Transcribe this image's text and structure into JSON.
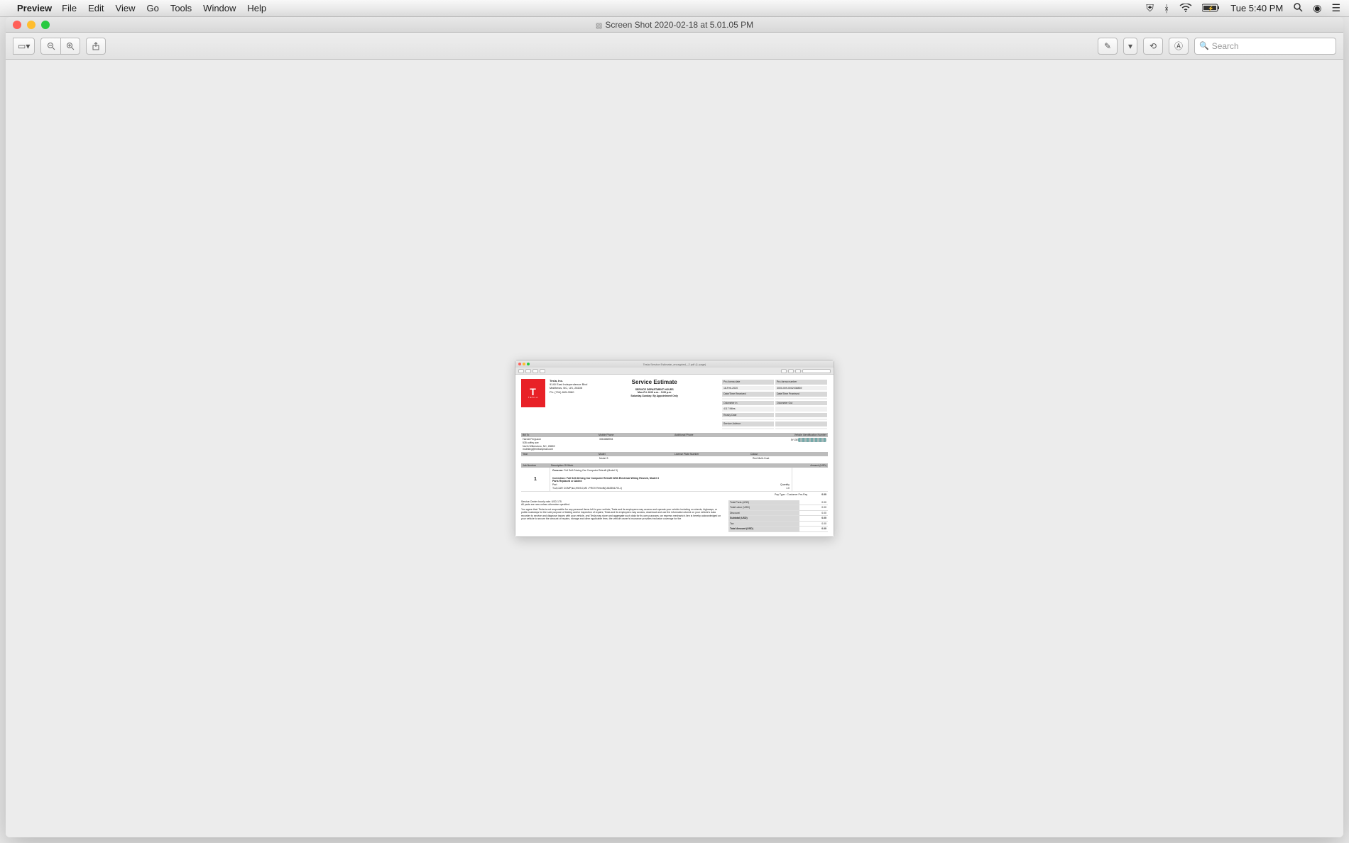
{
  "menubar": {
    "app": "Preview",
    "items": [
      "File",
      "Edit",
      "View",
      "Go",
      "Tools",
      "Window",
      "Help"
    ],
    "clock": "Tue 5:40 PM"
  },
  "window": {
    "title": "Screen Shot 2020-02-18 at 5.01.05 PM",
    "search_placeholder": "Search"
  },
  "inner": {
    "title": "Tesla Service Estimate_encrypted_-2.pdf (1 page)"
  },
  "doc": {
    "company": {
      "name": "Tesla, Inc.",
      "addr1": "9140 East Independence Blvd",
      "addr2": "Matthews, NC, US, 28105",
      "phone": "Ph: (704) 845-0980"
    },
    "title": "Service Estimate",
    "dept": {
      "header": "SERVICE DEPARTMENT HOURS",
      "line1": "Mon-Fri: 8:00 a.m. - 5:00 p.m",
      "line2": "Saturday-Sunday: By Appointment Only"
    },
    "meta": {
      "proforma_date_lbl": "Pro-forma date",
      "proforma_date": "18-Feb-2020",
      "proforma_num_lbl": "Pro-forma number",
      "proforma_num": "3000-009-0002038839",
      "dt_recv_lbl": "Date/Time Received",
      "dt_prom_lbl": "Date/Time Promised",
      "odo_in_lbl": "Odometer In",
      "odo_in": "4117 Miles",
      "odo_out_lbl": "Odometer Out",
      "ready_lbl": "Ready Date",
      "advisor_lbl": "Service Advisor"
    },
    "cust": {
      "billto_lbl": "Bill To",
      "mobile_lbl": "Mobile Phone",
      "addl_lbl": "Additional Phone",
      "vin_lbl": "Vehicle Identification Number",
      "name": "Harold Ferguson",
      "addr": "535 coffey ave",
      "city": "North Wilkesboro, NC, 28659",
      "email": "mulefarg@embarqmail.com",
      "mobile": "3364688904",
      "vin_prefix": "5YJ3E",
      "year_lbl": "Year",
      "model_lbl": "Model",
      "plate_lbl": "License Plate Number",
      "color_lbl": "Colour",
      "model": "Model 3",
      "color": "Red Multi-Coat"
    },
    "job": {
      "hdr_num": "Job Number",
      "hdr_desc": "Description Of Work",
      "hdr_amt": "Amount (USD)",
      "num": "1",
      "concern_lbl": "Concern:",
      "concern": "Full Self-Driving Car Computer Retrofit (Model 3)",
      "correction_lbl": "Correction:",
      "correction": "Full Self-Driving Car Computer Retrofit With Electrical Wiring Rework, Model 3",
      "parts_lbl": "Parts Replaced or Added",
      "part_lbl": "Part",
      "qty_lbl": "Quantity",
      "part": "TLA,CAR COMP,NA,HW3.0,M3 -PROV Retrofit(1462554-R0-J)",
      "qty": "1.0",
      "paytype_lbl": "Pay Type : Customer Pre-Pay",
      "paytype_amt": "0.00"
    },
    "footer": {
      "rate": "Service Center hourly rate: USD 175",
      "new": "All parts are new unless otherwise specified.",
      "disc": "You agree that: Tesla is not responsible for any personal items left in your vehicle; Tesla and its employees may access and operate your vehicle including on streets, highways, or public roadways for the sole purpose of testing and/or inspection of repairs; Tesla and its employees may access, download and use the information stored on your vehicle's data recorder to service and diagnose issues with your vehicle, and Tesla may store and aggregate such data for its own purposes; an express mechanic's lien is hereby acknowledged on your vehicle to secure the amount of repairs, storage and other applicable fees; the vehicle owner's insurance provides exclusive coverage for the"
    },
    "totals": {
      "parts_lbl": "Total Parts (USD)",
      "parts": "0.00",
      "labor_lbl": "Total Labor (USD)",
      "labor": "0.00",
      "disc_lbl": "Discount",
      "disc": "0.00",
      "sub_lbl": "Subtotal (USD)",
      "sub": "0.00",
      "tax_lbl": "Tax",
      "tax": "0.00",
      "total_lbl": "Total Amount (USD)",
      "total": "0.00"
    }
  }
}
